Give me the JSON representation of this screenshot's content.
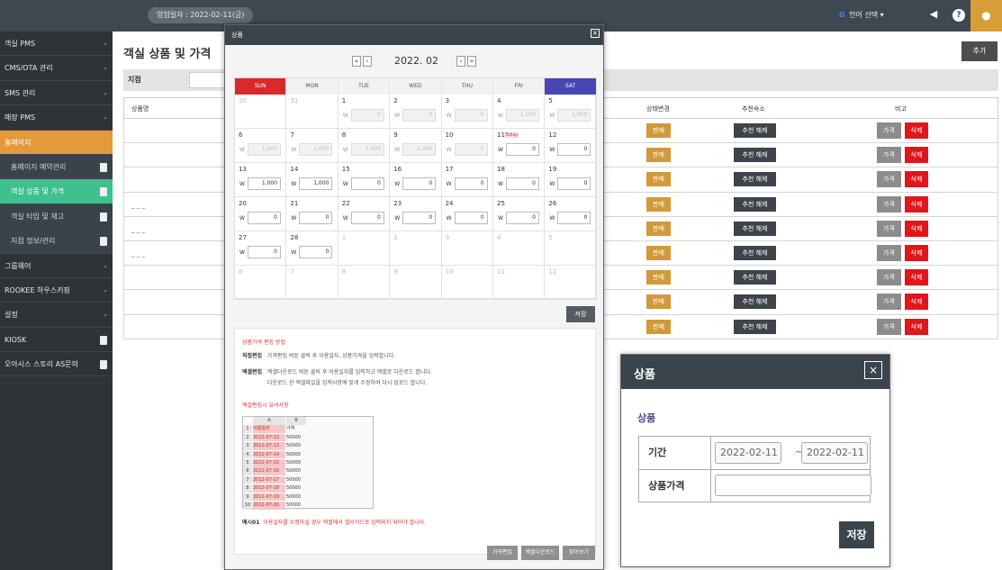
{
  "topbar": {
    "business_date": "영업일자 : 2022-02-11(금)",
    "language_label": "언어 선택",
    "icons": [
      "megaphone-icon",
      "help-icon",
      "user-icon"
    ]
  },
  "sidebar": {
    "items": [
      {
        "label": "객실 PMS",
        "chevron": "⌄"
      },
      {
        "label": "CMS/OTA 관리",
        "chevron": "⌄"
      },
      {
        "label": "SMS 관리",
        "chevron": "⌄"
      },
      {
        "label": "매장 PMS",
        "chevron": "⌄"
      },
      {
        "label": "홈페이지",
        "chevron": ""
      },
      {
        "label": "홈페이지 예약관리",
        "chevron": ""
      },
      {
        "label": "객실 상품 및 가격",
        "chevron": ""
      },
      {
        "label": "객실 타입 및 재고",
        "chevron": ""
      },
      {
        "label": "지점 정보/관리",
        "chevron": ""
      },
      {
        "label": "그룹웨어",
        "chevron": "⌄"
      },
      {
        "label": "ROOKEE 하우스키핑",
        "chevron": "⌄"
      },
      {
        "label": "설정",
        "chevron": "⌄"
      },
      {
        "label": "KIOSK",
        "chevron": ""
      },
      {
        "label": "오아시스 스토리 AS문의",
        "chevron": ""
      }
    ]
  },
  "main": {
    "title": "객실 상품 및 가격",
    "add_label": "추가",
    "filter_label": "지점",
    "table": {
      "headers": [
        "상품명",
        "상태변경",
        "추천숙소",
        "비고"
      ],
      "rows": [
        {
          "name": ""
        },
        {
          "name": ""
        },
        {
          "name": ""
        },
        {
          "name": "_ _ _"
        },
        {
          "name": "_ _ _"
        },
        {
          "name": "_ _ _"
        },
        {
          "name": ""
        },
        {
          "name": ""
        },
        {
          "name": ""
        }
      ],
      "sell_label": "판매",
      "rec_label": "추천 해제",
      "price_label": "가격",
      "delete_label": "삭제"
    }
  },
  "modal1": {
    "title": "상품",
    "close": "×",
    "month": "2022. 02",
    "nav": [
      "«",
      "‹",
      "›",
      "»"
    ],
    "weekdays": [
      "SUN",
      "MON",
      "TUE",
      "WED",
      "THU",
      "FRI",
      "SAT"
    ],
    "currency": "W",
    "today_label": "Today",
    "weeks": [
      [
        {
          "d": "30",
          "o": 1
        },
        {
          "d": "31",
          "o": 1
        },
        {
          "d": "1",
          "p": 1,
          "v": "0"
        },
        {
          "d": "2",
          "p": 1,
          "v": "0"
        },
        {
          "d": "3",
          "p": 1,
          "v": "0"
        },
        {
          "d": "4",
          "p": 1,
          "v": "1,000"
        },
        {
          "d": "5",
          "p": 1,
          "v": "1,000"
        }
      ],
      [
        {
          "d": "6",
          "p": 1,
          "v": "1,000"
        },
        {
          "d": "7",
          "p": 1,
          "v": "1,000"
        },
        {
          "d": "8",
          "p": 1,
          "v": "1,000"
        },
        {
          "d": "9",
          "p": 1,
          "v": "1,000"
        },
        {
          "d": "10",
          "p": 1,
          "v": "0"
        },
        {
          "d": "11",
          "v": "0",
          "t": 1
        },
        {
          "d": "12",
          "v": "0"
        }
      ],
      [
        {
          "d": "13",
          "v": "1,000"
        },
        {
          "d": "14",
          "v": "1,000"
        },
        {
          "d": "15",
          "v": "0"
        },
        {
          "d": "16",
          "v": "0"
        },
        {
          "d": "17",
          "v": "0"
        },
        {
          "d": "18",
          "v": "0"
        },
        {
          "d": "19",
          "v": "0"
        }
      ],
      [
        {
          "d": "20",
          "v": "0"
        },
        {
          "d": "21",
          "v": "0"
        },
        {
          "d": "22",
          "v": "0"
        },
        {
          "d": "23",
          "v": "0"
        },
        {
          "d": "24",
          "v": "0"
        },
        {
          "d": "25",
          "v": "0"
        },
        {
          "d": "26",
          "v": "0"
        }
      ],
      [
        {
          "d": "27",
          "v": "0"
        },
        {
          "d": "28",
          "v": "0"
        },
        {
          "d": "1",
          "o": 1
        },
        {
          "d": "2",
          "o": 1
        },
        {
          "d": "3",
          "o": 1
        },
        {
          "d": "4",
          "o": 1
        },
        {
          "d": "5",
          "o": 1
        }
      ],
      [
        {
          "d": "6",
          "o": 1
        },
        {
          "d": "7",
          "o": 1
        },
        {
          "d": "8",
          "o": 1
        },
        {
          "d": "9",
          "o": 1
        },
        {
          "d": "10",
          "o": 1
        },
        {
          "d": "11",
          "o": 1
        },
        {
          "d": "12",
          "o": 1
        }
      ]
    ],
    "save_label": "저장",
    "guide": {
      "title": "상품가격 편집 방법",
      "direct_label": "직접편집",
      "direct_text": "가격편집 버튼 클릭 후 이용일자, 상품가격을 입력합니다.",
      "excel_label": "엑셀편집",
      "excel_text1": "엑셀다운로드 버튼 클릭 후 이용일자를 입력하고 엑셀로 다운로드 합니다.",
      "excel_text2": "다운로드 한 엑셀파일을 입력사항에 맞게 수정하여 다시 업로드 합니다.",
      "excel_title": "엑셀편집시 유의사항",
      "sheet_header": [
        "A",
        "B"
      ],
      "sheet_rows": [
        [
          "1",
          "이용일자",
          "가격"
        ],
        [
          "2",
          "2012-07-12",
          "50000"
        ],
        [
          "3",
          "2012-07-13",
          "50000"
        ],
        [
          "4",
          "2012-07-14",
          "50000"
        ],
        [
          "5",
          "2012-07-15",
          "50000"
        ],
        [
          "6",
          "2012-07-16",
          "50000"
        ],
        [
          "7",
          "2012-07-17",
          "50000"
        ],
        [
          "8",
          "2012-07-18",
          "50000"
        ],
        [
          "9",
          "2012-07-19",
          "50000"
        ],
        [
          "10",
          "2012-07-20",
          "50000"
        ]
      ],
      "example_label": "예시01",
      "example_text": "이용일자를 수정하실 경우 엑셀에서 셀서식으로 입력되지 되어야 합니다."
    },
    "buttons": [
      "가격편집",
      "엑셀다운로드",
      "찾아보기"
    ]
  },
  "modal2": {
    "title": "상품",
    "close": "×",
    "subtitle": "상품",
    "period_label": "기간",
    "start_date": "2022-02-11",
    "tilde": "~",
    "end_date": "2022-02-11",
    "price_label": "상품가격",
    "price_value": "",
    "save_label": "저장"
  },
  "colors": {
    "topbar": "#3d4850",
    "sidebar": "#2e3338",
    "accent_orange": "#e29a3a",
    "accent_green": "#3ec08f",
    "sell": "#d09a3a",
    "delete": "#e0161d",
    "sunday": "#d9292b",
    "saturday": "#4747b3"
  }
}
